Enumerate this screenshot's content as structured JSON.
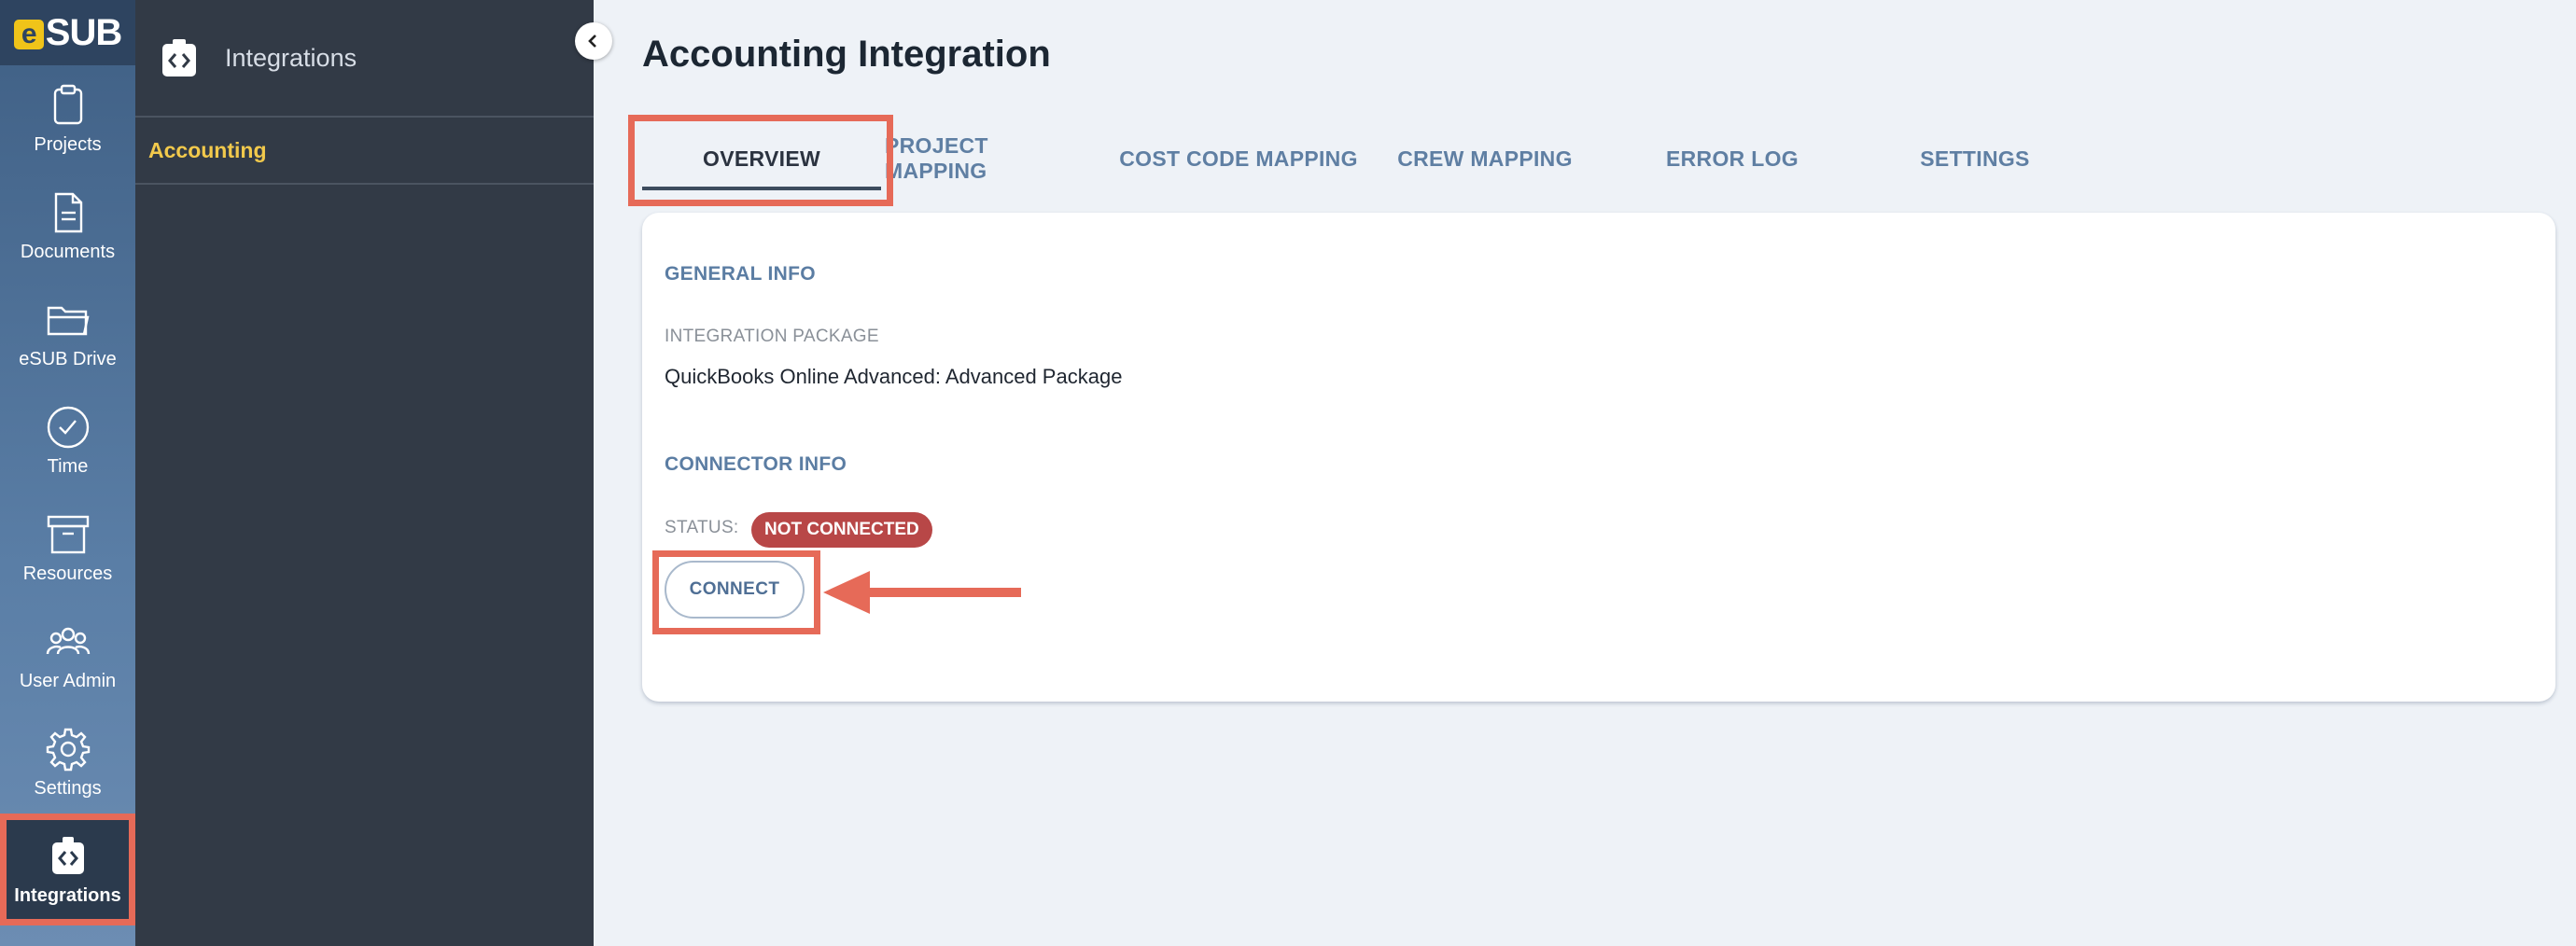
{
  "logo": {
    "text": "SUB",
    "letter": "e"
  },
  "rail": {
    "items": [
      {
        "label": "Projects",
        "icon": "clipboard-icon"
      },
      {
        "label": "Documents",
        "icon": "document-icon"
      },
      {
        "label": "eSUB Drive",
        "icon": "folder-icon"
      },
      {
        "label": "Time",
        "icon": "clock-icon"
      },
      {
        "label": "Resources",
        "icon": "archive-box-icon"
      },
      {
        "label": "User Admin",
        "icon": "users-icon"
      },
      {
        "label": "Settings",
        "icon": "gear-icon"
      },
      {
        "label": "Integrations",
        "icon": "integrations-icon",
        "active": true
      }
    ]
  },
  "subnav": {
    "title": "Integrations",
    "items": [
      {
        "label": "Accounting",
        "active": true
      }
    ]
  },
  "main": {
    "title": "Accounting Integration",
    "tabs": [
      {
        "label": "OVERVIEW",
        "active": true
      },
      {
        "label": "PROJECT MAPPING"
      },
      {
        "label": "COST CODE MAPPING"
      },
      {
        "label": "CREW MAPPING"
      },
      {
        "label": "ERROR LOG"
      },
      {
        "label": "SETTINGS"
      }
    ],
    "general_info": {
      "heading": "GENERAL INFO",
      "package_label": "INTEGRATION PACKAGE",
      "package_value": "QuickBooks Online Advanced: Advanced Package"
    },
    "connector_info": {
      "heading": "CONNECTOR INFO",
      "status_label": "STATUS:",
      "status_value": "NOT CONNECTED",
      "connect_label": "CONNECT"
    }
  },
  "colors": {
    "accent_highlight": "#e66a58",
    "status_badge": "#b84747",
    "subnav_active": "#f2c94c"
  }
}
